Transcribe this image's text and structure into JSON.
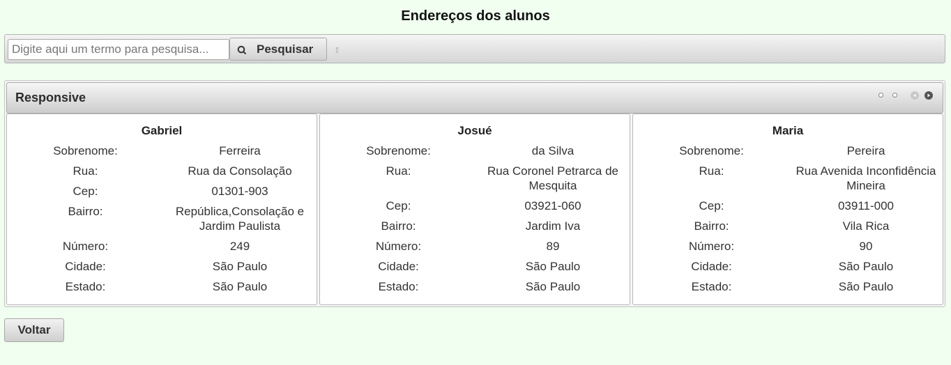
{
  "page": {
    "title": "Endereços dos alunos"
  },
  "toolbar": {
    "search_placeholder": "Digite aqui um termo para pesquisa...",
    "search_value": "",
    "search_label": "Pesquisar"
  },
  "panel": {
    "title": "Responsive",
    "labels": {
      "sobrenome": "Sobrenome:",
      "rua": "Rua:",
      "cep": "Cep:",
      "bairro": "Bairro:",
      "numero": "Número:",
      "cidade": "Cidade:",
      "estado": "Estado:"
    },
    "students": [
      {
        "name": "Gabriel",
        "sobrenome": "Ferreira",
        "rua": "Rua da Consolação",
        "cep": "01301-903",
        "bairro": "República,Consolação e Jardim Paulista",
        "numero": "249",
        "cidade": "São Paulo",
        "estado": "São Paulo"
      },
      {
        "name": "Josué",
        "sobrenome": "da Silva",
        "rua": "Rua Coronel Petrarca de Mesquita",
        "cep": "03921-060",
        "bairro": "Jardim Iva",
        "numero": "89",
        "cidade": "São Paulo",
        "estado": "São Paulo"
      },
      {
        "name": "Maria",
        "sobrenome": "Pereira",
        "rua": "Rua Avenida Inconfidência Mineira",
        "cep": "03911-000",
        "bairro": "Vila Rica",
        "numero": "90",
        "cidade": "São Paulo",
        "estado": "São Paulo"
      }
    ]
  },
  "footer": {
    "back_label": "Voltar"
  },
  "icons": {
    "search": "search-icon",
    "prev": "prev-arrow-icon",
    "next": "next-arrow-icon"
  }
}
